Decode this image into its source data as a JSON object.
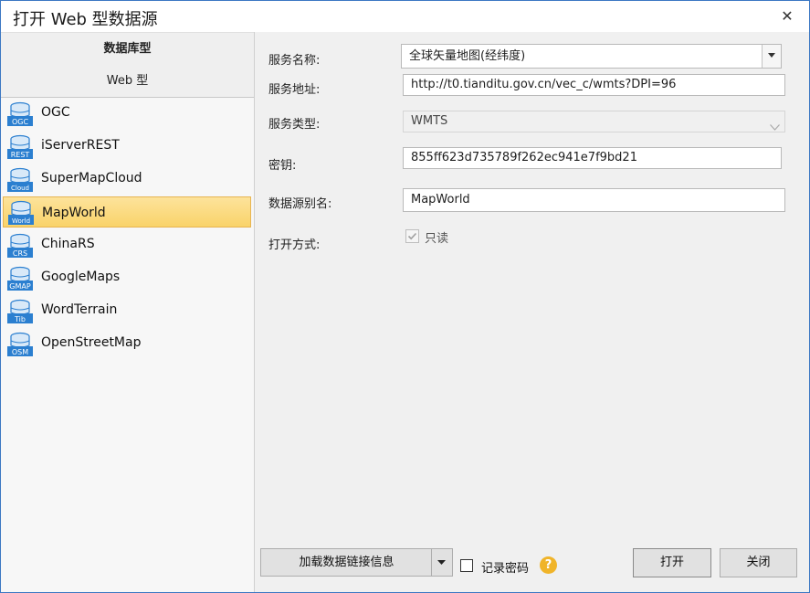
{
  "window": {
    "title": "打开 Web 型数据源"
  },
  "left": {
    "group_database": "数据库型",
    "group_web": "Web 型",
    "items": [
      {
        "label": "OGC",
        "badge": "OGC",
        "icon": "database-ogc-icon"
      },
      {
        "label": "iServerREST",
        "badge": "REST",
        "icon": "database-rest-icon"
      },
      {
        "label": "SuperMapCloud",
        "badge": "Cloud",
        "icon": "database-cloud-icon"
      },
      {
        "label": "MapWorld",
        "badge": "World",
        "icon": "database-world-icon",
        "selected": true
      },
      {
        "label": "ChinaRS",
        "badge": "CRS",
        "icon": "database-crs-icon"
      },
      {
        "label": "GoogleMaps",
        "badge": "GMAP",
        "icon": "database-gmap-icon"
      },
      {
        "label": "WordTerrain",
        "badge": "Tib",
        "icon": "database-tib-icon"
      },
      {
        "label": "OpenStreetMap",
        "badge": "OSM",
        "icon": "database-osm-icon"
      }
    ]
  },
  "form": {
    "service_name_label": "服务名称:",
    "service_name_value": "全球矢量地图(经纬度)",
    "service_url_label": "服务地址:",
    "service_url_value": "http://t0.tianditu.gov.cn/vec_c/wmts?DPI=96",
    "service_type_label": "服务类型:",
    "service_type_value": "WMTS",
    "key_label": "密钥:",
    "key_value": "855ff623d735789f262ec941e7f9bd21",
    "alias_label": "数据源别名:",
    "alias_value": "MapWorld",
    "open_mode_label": "打开方式:",
    "readonly_label": "只读",
    "readonly_checked": true
  },
  "bottom": {
    "load_button": "加载数据链接信息",
    "remember_password": "记录密码",
    "help_glyph": "?",
    "open_button": "打开",
    "close_button": "关闭"
  },
  "colors": {
    "accent_border": "#3c78c3",
    "selected_bg": "#f9d36a",
    "icon_blue": "#2b7fd0",
    "help": "#f0b429"
  }
}
